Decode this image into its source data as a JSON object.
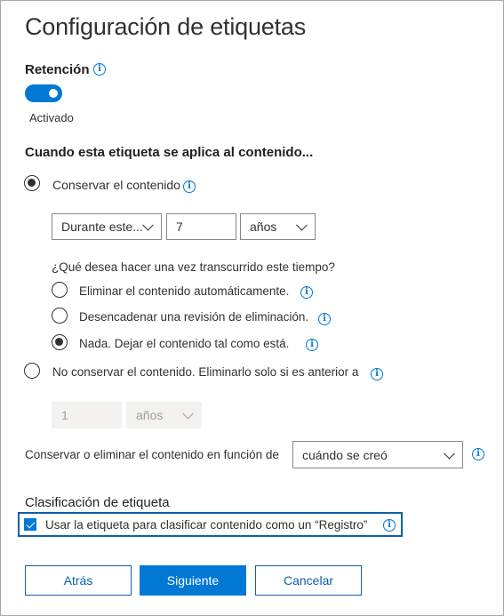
{
  "title": "Configuración de etiquetas",
  "retention": {
    "label": "Retención",
    "toggle_state": "Activado",
    "toggle_on": true
  },
  "apply_heading": "Cuando esta etiqueta se aplica al contenido...",
  "keep": {
    "label": "Conservar el contenido",
    "selected": true,
    "period_select": "Durante este...",
    "period_value": "7",
    "unit_select": "años"
  },
  "after_question": "¿Qué desea hacer una vez transcurrido este tiempo?",
  "after_options": [
    {
      "label": "Eliminar el contenido automáticamente.",
      "selected": false
    },
    {
      "label": "Desencadenar una revisión de eliminación.",
      "selected": false
    },
    {
      "label": "Nada. Dejar el contenido tal como está.",
      "selected": true
    }
  ],
  "delete_only": {
    "label": "No conservar el contenido. Eliminarlo solo si es anterior a",
    "selected": false,
    "value": "1",
    "unit": "años"
  },
  "based_on": {
    "label": "Conservar o eliminar el contenido en función de",
    "value": "cuándo se creó"
  },
  "classification": {
    "heading": "Clasificación de etiqueta",
    "checkbox_label": "Usar la etiqueta para clasificar contenido como un “Registro”",
    "checked": true
  },
  "buttons": {
    "back": "Atrás",
    "next": "Siguiente",
    "cancel": "Cancelar"
  },
  "colors": {
    "accent": "#0078d4",
    "border_focus": "#0f5fa8",
    "disabled_bg": "#f3f2f1"
  }
}
